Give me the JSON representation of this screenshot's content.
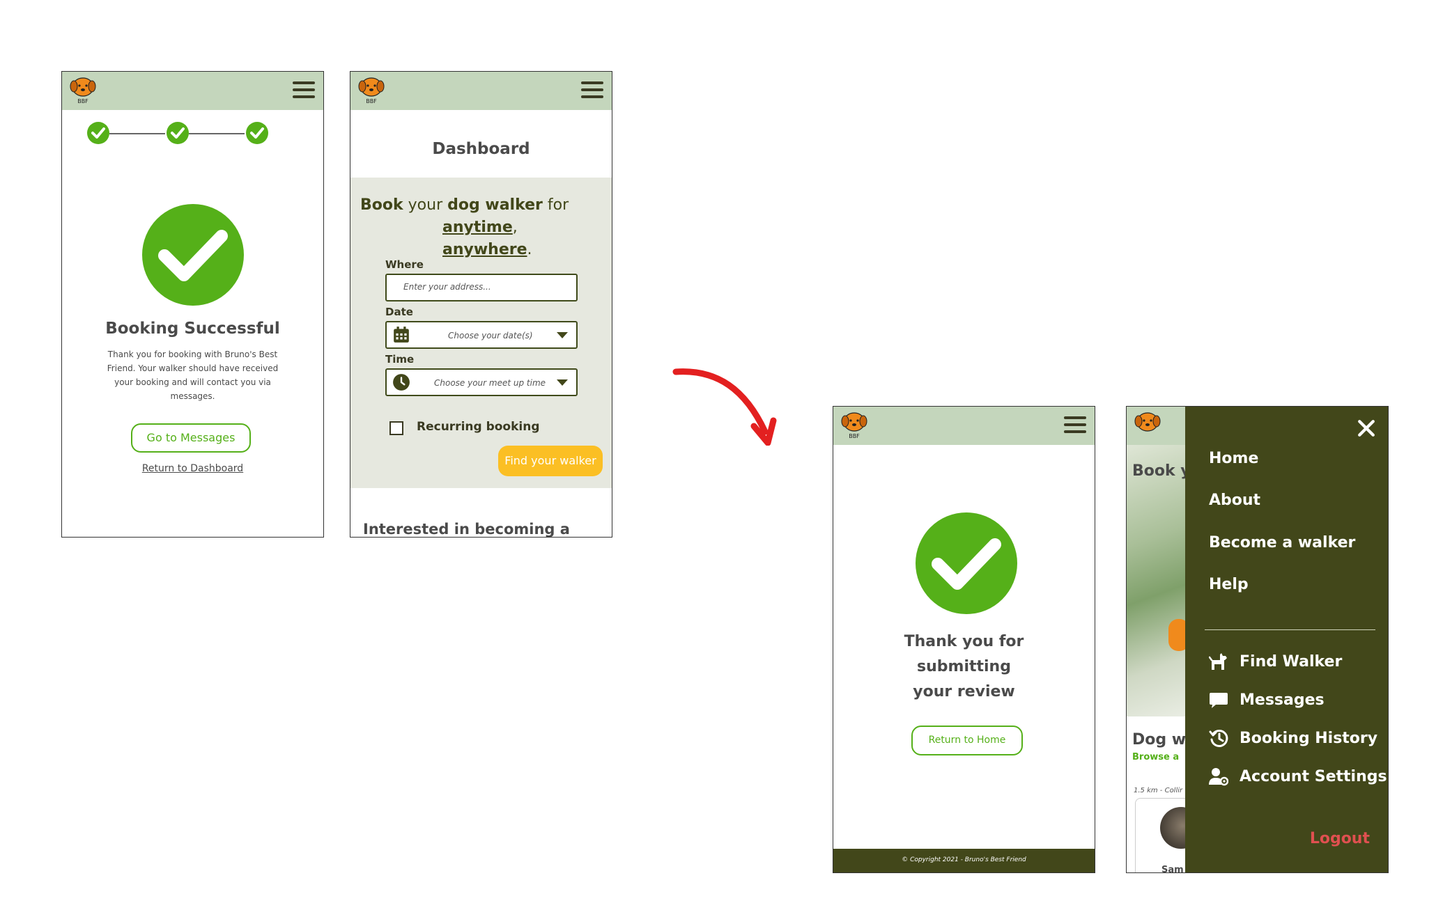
{
  "brand": {
    "logo_text": "BBF"
  },
  "screen1": {
    "title": "Booking Successful",
    "message": "Thank you for booking with Bruno's Best Friend. Your walker should have received your booking and will contact you via messages.",
    "messages_button": "Go to Messages",
    "dashboard_link": "Return to Dashboard"
  },
  "screen2": {
    "title": "Dashboard",
    "headline": {
      "w1": "Book",
      "w2": "your",
      "w3": "dog walker",
      "w4": "for",
      "w5": "anytime",
      "w6": ",",
      "w7": "anywhere",
      "w8": "."
    },
    "where_label": "Where",
    "where_placeholder": "Enter your address...",
    "date_label": "Date",
    "date_value": "Choose your date(s)",
    "time_label": "Time",
    "time_value": "Choose your meet up time",
    "recurring_label": "Recurring booking",
    "find_button": "Find your walker",
    "bottom_text": "Interested in becoming a"
  },
  "screen3": {
    "message": "Thank you for submitting your review",
    "home_button": "Return to Home",
    "footer": "© Copyright 2021 - Bruno's Best Friend"
  },
  "screen4": {
    "bg_texts": {
      "t1": "Book y",
      "t2": "Dog w",
      "t3": "Browse a",
      "t4": "1.5 km - Collir",
      "t5": "Sam"
    },
    "menu_primary": [
      "Home",
      "About",
      "Become a walker",
      "Help"
    ],
    "menu_secondary": [
      {
        "label": "Find Walker",
        "icon": "dog-icon"
      },
      {
        "label": "Messages",
        "icon": "chat-bubble-icon"
      },
      {
        "label": "Booking History",
        "icon": "history-icon"
      },
      {
        "label": "Account Settings",
        "icon": "user-gear-icon"
      }
    ],
    "logout": "Logout"
  },
  "colors": {
    "green": "#55b019",
    "olive": "#42471a",
    "header": "#c4d6bc",
    "yellow": "#fbbf24",
    "red_arrow": "#e32020",
    "logout": "#e05050"
  }
}
